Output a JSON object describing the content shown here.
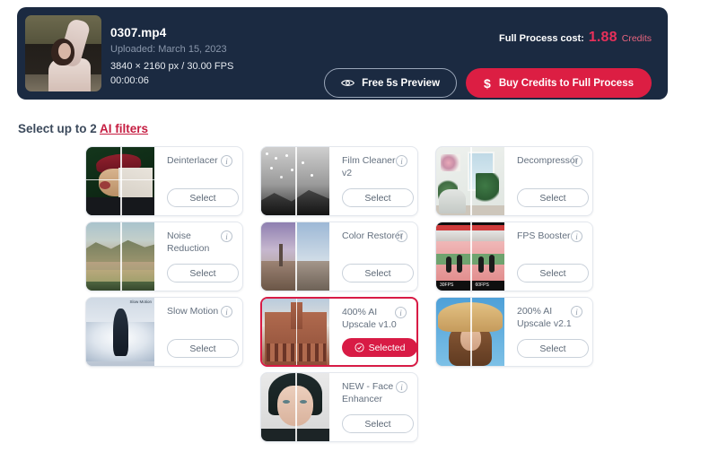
{
  "hero": {
    "filename": "0307.mp4",
    "uploaded": "Uploaded: March 15, 2023",
    "resolution": "3840 × 2160 px / 30.00 FPS",
    "duration": "00:00:06",
    "cost_label": "Full Process cost:",
    "cost_value": "1.88",
    "cost_unit": "Credits",
    "preview_button": "Free 5s Preview",
    "buy_button": "Buy Credits to Full Process",
    "dollar_glyph": "$",
    "accent_red": "#dc1e43",
    "panel_bg": "#1b2a41"
  },
  "section": {
    "title_prefix": "Select up to 2 ",
    "title_link": "AI filters"
  },
  "labels": {
    "select": "Select",
    "selected": "Selected",
    "info": "i"
  },
  "filters": [
    {
      "name": "Deinterlacer",
      "state": "Select",
      "selected": false
    },
    {
      "name": "Film Cleaner v2",
      "state": "Select",
      "selected": false
    },
    {
      "name": "Decompressor",
      "state": "Select",
      "selected": false
    },
    {
      "name": "Noise Reduction",
      "state": "Select",
      "selected": false
    },
    {
      "name": "Color Restorer",
      "state": "Select",
      "selected": false
    },
    {
      "name": "FPS Booster",
      "state": "Select",
      "selected": false
    },
    {
      "name": "Slow Motion",
      "state": "Select",
      "selected": false
    },
    {
      "name": "400% AI Upscale v1.0",
      "state": "Selected",
      "selected": true
    },
    {
      "name": "200% AI Upscale v2.1",
      "state": "Select",
      "selected": false
    },
    {
      "name": "NEW - Face Enhancer",
      "state": "Select",
      "selected": false
    }
  ],
  "thumb_tags": {
    "fps_left": "30FPS",
    "fps_right": "60FPS",
    "slow_watermark": "Slow Motion"
  }
}
